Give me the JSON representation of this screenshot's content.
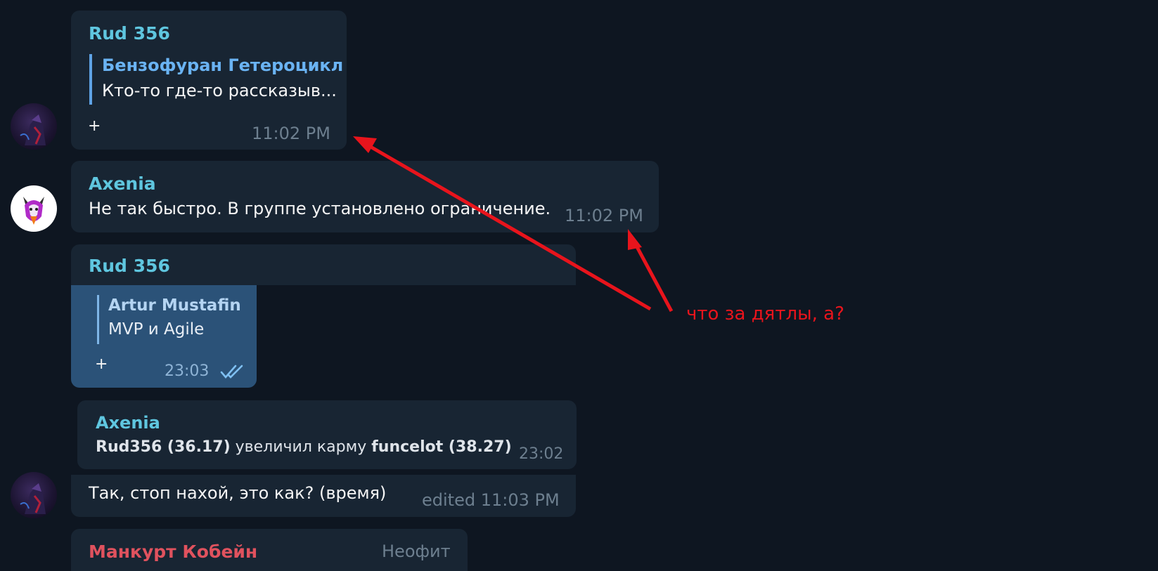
{
  "messages": {
    "m1": {
      "sender": "Rud 356",
      "reply_author": "Бензофуран Гетероцикл",
      "reply_text": "Кто-то где-то рассказыв...",
      "text": "+",
      "time": "11:02 PM"
    },
    "m2": {
      "sender": "Axenia",
      "text": "Не так быстро. В группе установлено ограничение.",
      "time": "11:02 PM"
    },
    "m3": {
      "sender": "Rud 356",
      "quoted": {
        "reply_author": "Artur Mustafin",
        "reply_text": "MVP и Agile",
        "text": "+",
        "time": "23:03"
      },
      "forwarded": {
        "sender": "Axenia",
        "user1": "Rud356 (36.17)",
        "action": "увеличил карму",
        "user2": "funcelot (38.27)",
        "time": "23:02"
      },
      "text": "Так, стоп нахой, это как? (время)",
      "time": "edited 11:03 PM"
    },
    "m4": {
      "sender": "Манкурт Кобейн",
      "badge": "Неофит"
    }
  },
  "annotation": {
    "text": "что за дятлы, а?",
    "color": "#e8141c"
  },
  "icons": {
    "read_check": "double-check-icon"
  }
}
